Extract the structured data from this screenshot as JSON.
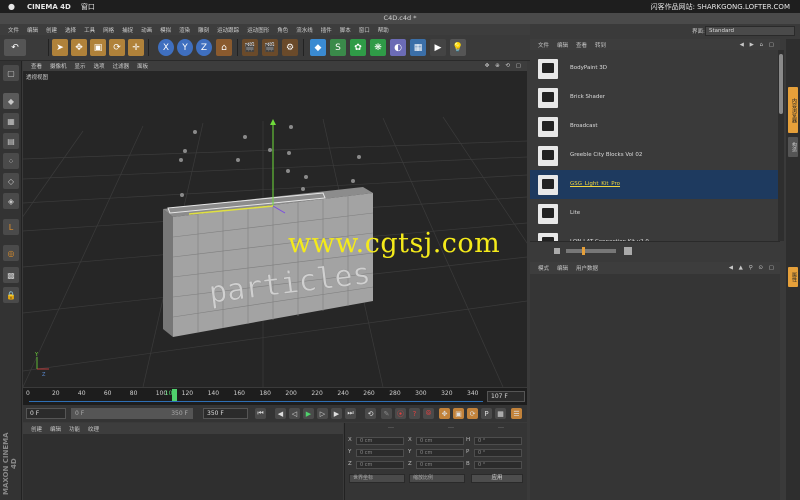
{
  "macbar": {
    "apple": "",
    "app": "CINEMA 4D",
    "menu": "窗口",
    "right": "闪客作品网站: SHARKGONG.LOFTER.COM"
  },
  "window": {
    "title": "C4D.c4d *"
  },
  "mainmenu": [
    "文件",
    "编辑",
    "创建",
    "选择",
    "工具",
    "网格",
    "捕捉",
    "动画",
    "模拟",
    "渲染",
    "雕刻",
    "运动跟踪",
    "运动图形",
    "角色",
    "流水线",
    "插件",
    "脚本",
    "窗口",
    "帮助"
  ],
  "viewport": {
    "menu": [
      "查看",
      "摄像机",
      "显示",
      "选项",
      "过滤器",
      "面板"
    ],
    "icons": "✥ ⊕ ⟲ ▢",
    "label": "透视视图",
    "watermark": "www.cgtsj.com",
    "text3d": "particles"
  },
  "timeline": {
    "ticks": [
      "0",
      "20",
      "40",
      "60",
      "80",
      "100",
      "107",
      "120",
      "140",
      "160",
      "180",
      "200",
      "220",
      "240",
      "260",
      "280",
      "300",
      "320",
      "340"
    ],
    "current_frame": "107 F",
    "playhead_frame": 107,
    "start_field": "0 F",
    "range_start": "0 F",
    "range_end": "350 F",
    "end_field": "350 F"
  },
  "material": {
    "menu": [
      "创建",
      "编辑",
      "功能",
      "纹理"
    ],
    "brand": "MAXON CINEMA 4D"
  },
  "coords": {
    "header": [
      "---",
      "---",
      "---"
    ],
    "rows": [
      {
        "a": "X",
        "av": "0 cm",
        "b": "X",
        "bv": "0 cm",
        "c": "H",
        "cv": "0 °"
      },
      {
        "a": "Y",
        "av": "0 cm",
        "b": "Y",
        "bv": "0 cm",
        "c": "P",
        "cv": "0 °"
      },
      {
        "a": "Z",
        "av": "0 cm",
        "b": "Z",
        "bv": "0 cm",
        "c": "B",
        "cv": "0 °"
      }
    ],
    "mode_select": "世界坐标",
    "size_select": "缩放比例",
    "apply": "应用"
  },
  "layout": {
    "label": "界面:",
    "value": "Standard"
  },
  "browser": {
    "menu": [
      "文件",
      "编辑",
      "查看",
      "转到"
    ],
    "icons": "◀ ▶ ⌂ ▢",
    "items": [
      {
        "name": "BodyPaint 3D",
        "selected": false
      },
      {
        "name": "Brick Shader",
        "selected": false
      },
      {
        "name": "Broadcast",
        "selected": false
      },
      {
        "name": "Greeble City Blocks Vol 02",
        "selected": false
      },
      {
        "name": "GSG_Light_Kit_Pro",
        "selected": true
      },
      {
        "name": "Lite",
        "selected": false
      },
      {
        "name": "LON-LAT Connection Kit v2.0",
        "selected": false
      }
    ]
  },
  "attributes": {
    "menu": [
      "模式",
      "编辑",
      "用户数据"
    ],
    "icons": "◀ ▲ ⚲ ⊙ ▢"
  },
  "sidetabs": [
    "内容浏览器",
    "构造",
    "属性"
  ],
  "colors": {
    "accent_blue": "#2e6fb5",
    "selected_row": "#1e3a5f",
    "watermark_yellow": "#f4ea1a",
    "playhead_green": "#4fd16c"
  }
}
